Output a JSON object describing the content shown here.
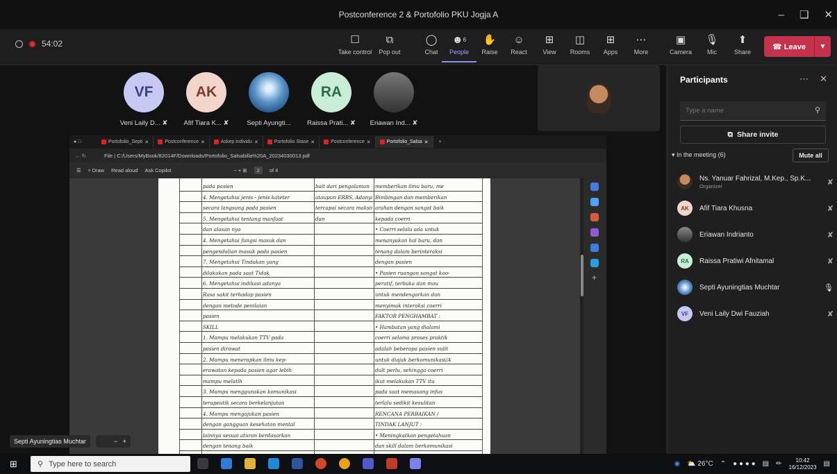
{
  "window": {
    "title": "Postconference 2 & Portofolio PKU Jogja A"
  },
  "meeting": {
    "elapsed": "54:02"
  },
  "toolbar": {
    "buttons": [
      {
        "label": "Take control",
        "icon": "take-control-icon"
      },
      {
        "label": "Pop out",
        "icon": "pop-out-icon"
      },
      {
        "label": "Chat",
        "icon": "chat-icon"
      },
      {
        "label": "People",
        "icon": "people-icon",
        "badge": "6"
      },
      {
        "label": "Raise",
        "icon": "raise-hand-icon"
      },
      {
        "label": "React",
        "icon": "react-icon"
      },
      {
        "label": "View",
        "icon": "view-icon"
      },
      {
        "label": "Rooms",
        "icon": "rooms-icon"
      },
      {
        "label": "Apps",
        "icon": "apps-icon"
      },
      {
        "label": "More",
        "icon": "more-icon"
      },
      {
        "label": "Camera",
        "icon": "camera-off-icon"
      },
      {
        "label": "Mic",
        "icon": "mic-off-icon"
      },
      {
        "label": "Share",
        "icon": "share-icon"
      }
    ],
    "leave_label": "Leave"
  },
  "stage": {
    "tiles": [
      {
        "initials": "VF",
        "name": "Veni Laily D...",
        "color": "#c7c9f3",
        "text": "#3b3f8c"
      },
      {
        "initials": "AK",
        "name": "Afif Tiara K...",
        "color": "#f2d6cc",
        "text": "#7a3b2a"
      },
      {
        "initials": "",
        "name": "Septi Ayungti...",
        "color": "#4a7fb5",
        "text": "#fff"
      },
      {
        "initials": "RA",
        "name": "Raissa Prati...",
        "color": "#c9eed8",
        "text": "#2a6b45"
      },
      {
        "initials": "",
        "name": "Eriawan Ind...",
        "color": "#555",
        "text": "#fff"
      }
    ],
    "presenter": "Septi Ayuningtias Muchtar"
  },
  "browser": {
    "tabs": [
      "Portofolio_Septi",
      "Postconference",
      "Askep individu",
      "Portofolio Stase",
      "Postconference",
      "Portofolio_Salsa"
    ],
    "url": "File  |  C:/Users/MyBook/82014F/Downloads/Portofolio_Salsabilla%20A_20234030013.pdf",
    "pdf_toolbar": {
      "draw": "Draw",
      "read_aloud": "Read aloud",
      "ask_copilot": "Ask Copilot",
      "page": "2",
      "of_pages": "of 4"
    },
    "document_lines": [
      [
        "pada pasien",
        "bait dari pengalaman",
        "memberikan ilmu baru, me"
      ],
      [
        "4. Mengetahui jenis - jenis kateter",
        "ataupun ERBS, Adanya",
        "Bimbingan dan memberikan"
      ],
      [
        "secara langsung pada pasien",
        "tercapai secara maksimal",
        "arahan dengan sangat baik"
      ],
      [
        "5. Mengetahui tentang manfaat",
        "dan",
        "kepada coerri"
      ],
      [
        "dan alasan nya",
        "",
        "• Coerri selalu ada untuk"
      ],
      [
        "4. Mengetahui fungsi masuk dan",
        "",
        "menanyakan hal baru, dan"
      ],
      [
        "pengendalian masuk pada pasien",
        "",
        "tenang dalam berinteraksi"
      ],
      [
        "7. Mengetahui Tindakan yang",
        "",
        "dengan pasien"
      ],
      [
        "dilakukan pada saat Tidak",
        "",
        "• Pasien ruangan sangat koo-"
      ],
      [
        "6. Mengetahui indikasi adanya",
        "",
        "peratif, terbuka dan mau"
      ],
      [
        "Rasa sakit terhadap pasien",
        "",
        "untuk mendengarkan dan"
      ],
      [
        "dengan metode penilaian",
        "",
        "menyimak interaksi coerri"
      ],
      [
        "pasien",
        "",
        "FAKTOR PENGHAMBAT :"
      ],
      [
        "SKILL",
        "",
        "• Hambatan yang dialami"
      ],
      [
        "1. Mampu melakukan TTV pada",
        "",
        "coerri selama proses praktik"
      ],
      [
        "pasien dirawat",
        "",
        "adalah beberapa pasien sulit"
      ],
      [
        "2. Mampu menerapkan ilmu kep-",
        "",
        "untuk diajak berkomunikasi/A"
      ],
      [
        "erawatan kepada pasien agar lebih",
        "",
        "dult perlu, sehingga coerri"
      ],
      [
        "mampu melatih",
        "",
        "ikut melakukan TTV itu"
      ],
      [
        "3. Mampu menggunakan komunikasi",
        "",
        "pada saat memasang infus"
      ],
      [
        "terapeutik secara berkelanjutan",
        "",
        "terlalu sedikit kesulitan"
      ],
      [
        "4. Mampu mengajukan pasien",
        "",
        "RENCANA PERBAIKAN /"
      ],
      [
        "dengan gangguan kesehatan mental",
        "",
        "TINDAK LANJUT :"
      ],
      [
        "lainnya sesuai aturan berdasarkan",
        "",
        "• Meningkatkan pengetahuan"
      ],
      [
        "dengan tenang baik",
        "",
        "dan skill dalam berkomunikasi"
      ]
    ]
  },
  "participants_panel": {
    "title": "Participants",
    "search_placeholder": "Type a name",
    "share_invite": "Share invite",
    "in_meeting": "In the meeting (6)",
    "mute_all": "Mute all",
    "people": [
      {
        "name": "Ns. Yanuar Fahrizal, M.Kep., Sp.K...",
        "role": "Organizer",
        "initials": "",
        "color": "#6a5a4a",
        "mic": "mic-off-icon"
      },
      {
        "name": "Afif Tiara Khusna",
        "role": "",
        "initials": "AK",
        "color": "#f2d6cc",
        "mic": "mic-off-icon"
      },
      {
        "name": "Eriawan Indrianto",
        "role": "",
        "initials": "",
        "color": "#555",
        "mic": "mic-off-icon"
      },
      {
        "name": "Raissa Pratiwi Afnitamal",
        "role": "",
        "initials": "RA",
        "color": "#c9eed8",
        "mic": "mic-off-icon"
      },
      {
        "name": "Septi Ayuningtias Muchtar",
        "role": "",
        "initials": "",
        "color": "#4a7fb5",
        "mic": "mic-on-icon"
      },
      {
        "name": "Veni Laily Dwi Fauziah",
        "role": "",
        "initials": "VF",
        "color": "#c7c9f3",
        "mic": "mic-off-icon"
      }
    ]
  },
  "taskbar": {
    "search_placeholder": "Type here to search",
    "weather": "26°C",
    "time": "10:42",
    "date": "16/12/2023"
  }
}
